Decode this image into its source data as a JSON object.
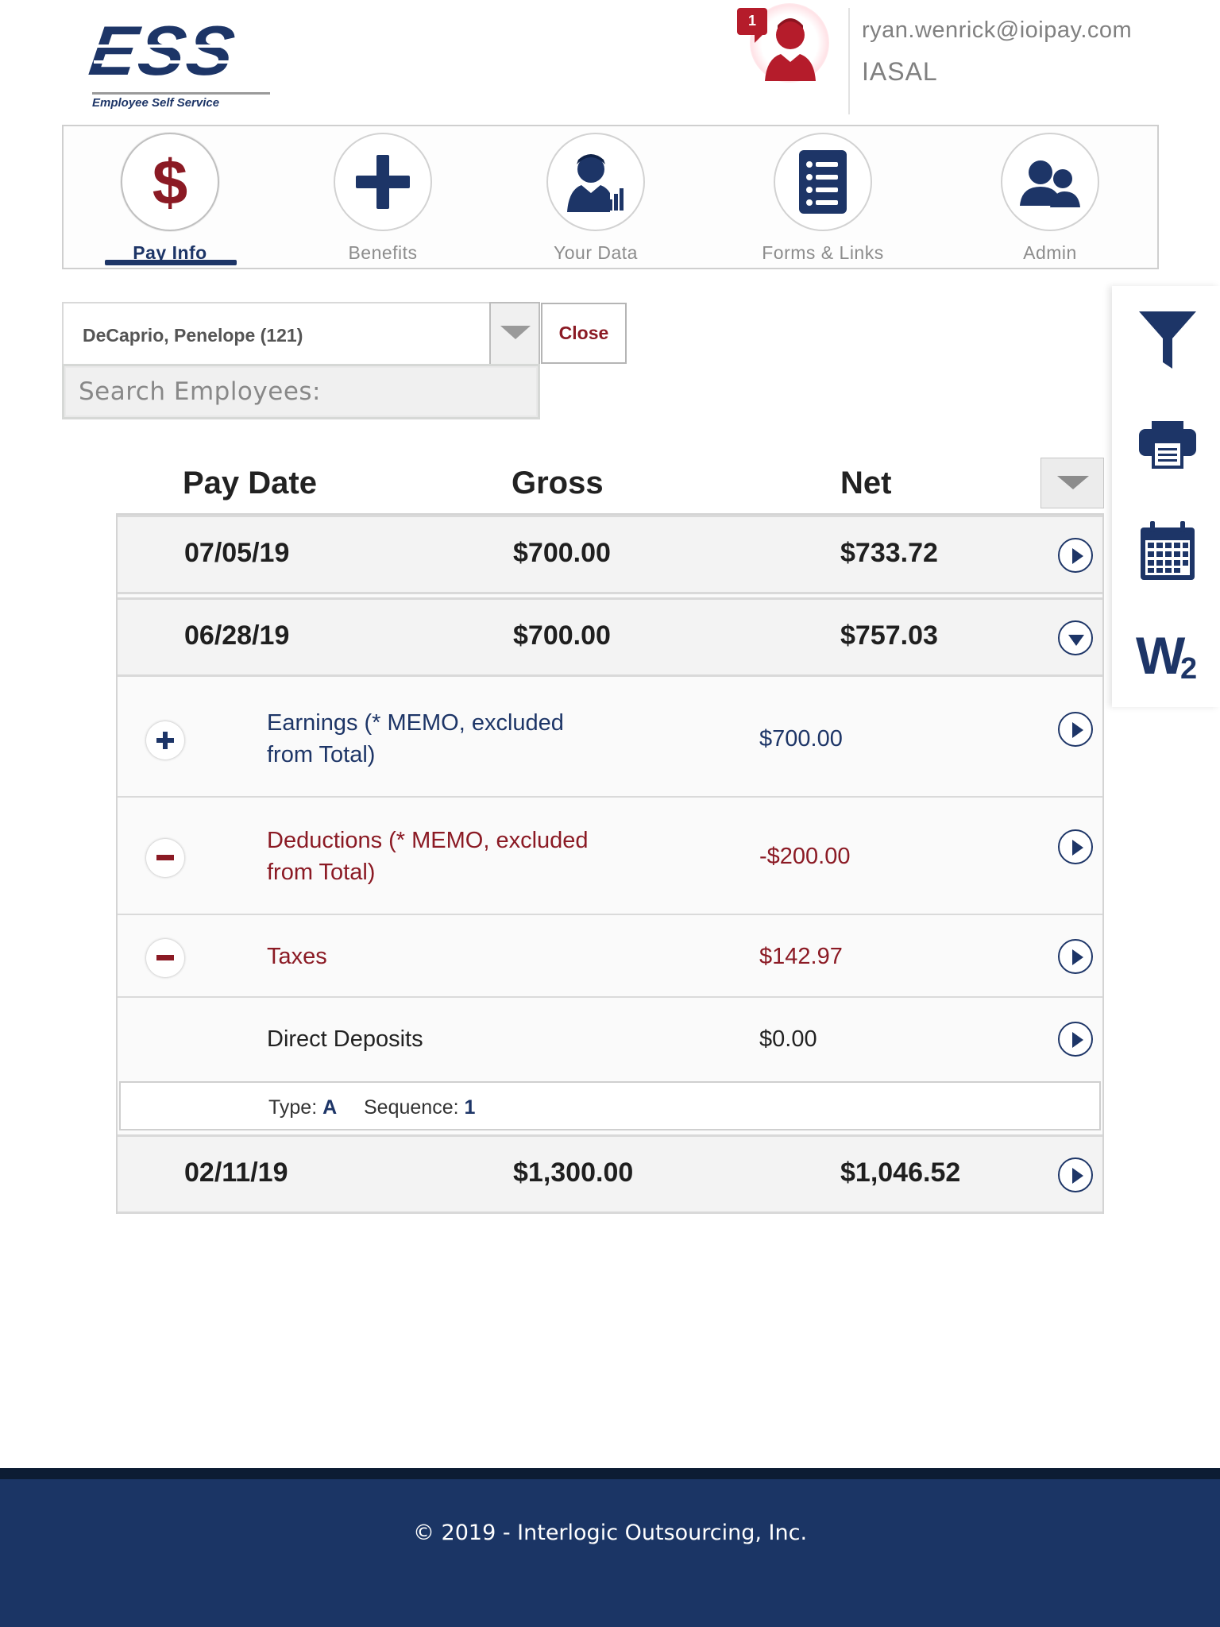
{
  "header": {
    "logo_text": "ESS",
    "logo_tagline": "Employee Self Service",
    "notification_count": "1",
    "user_email": "ryan.wenrick@ioipay.com",
    "user_company": "IASAL"
  },
  "nav": {
    "items": [
      {
        "label": "Pay Info",
        "icon": "dollar-icon",
        "active": true
      },
      {
        "label": "Benefits",
        "icon": "plus-icon",
        "active": false
      },
      {
        "label": "Your Data",
        "icon": "person-chart-icon",
        "active": false
      },
      {
        "label": "Forms & Links",
        "icon": "list-document-icon",
        "active": false
      },
      {
        "label": "Admin",
        "icon": "users-icon",
        "active": false
      }
    ]
  },
  "employee": {
    "selected": "DeCaprio, Penelope (121)",
    "close_label": "Close",
    "search_placeholder": "Search Employees:"
  },
  "rail": {
    "items": [
      "filter-icon",
      "printer-icon",
      "calendar-icon",
      "w2-icon"
    ],
    "w2_label": "W2"
  },
  "table": {
    "headers": {
      "date": "Pay Date",
      "gross": "Gross",
      "net": "Net"
    },
    "rows": [
      {
        "date": "07/05/19",
        "gross": "$700.00",
        "net": "$733.72",
        "expanded": false
      },
      {
        "date": "06/28/19",
        "gross": "$700.00",
        "net": "$757.03",
        "expanded": true
      },
      {
        "date": "02/11/19",
        "gross": "$1,300.00",
        "net": "$1,046.52",
        "expanded": false
      }
    ],
    "details": {
      "earnings": {
        "label_line1": "Earnings (* MEMO, excluded",
        "label_line2": "from Total)",
        "amount": "$700.00"
      },
      "deductions": {
        "label_line1": "Deductions (* MEMO, excluded",
        "label_line2": "from Total)",
        "amount": "-$200.00"
      },
      "taxes": {
        "label": "Taxes",
        "amount": "$142.97"
      },
      "deposits": {
        "label": "Direct Deposits",
        "amount": "$0.00"
      },
      "deposit_info": {
        "type_label": "Type:",
        "type_value": "A",
        "seq_label": "Sequence:",
        "seq_value": "1"
      }
    }
  },
  "footer": {
    "copyright": "© 2019 - Interlogic Outsourcing, Inc."
  },
  "colors": {
    "brand_navy": "#1d3567",
    "brand_red": "#8b1a24",
    "footer_bg": "#1b3565"
  }
}
